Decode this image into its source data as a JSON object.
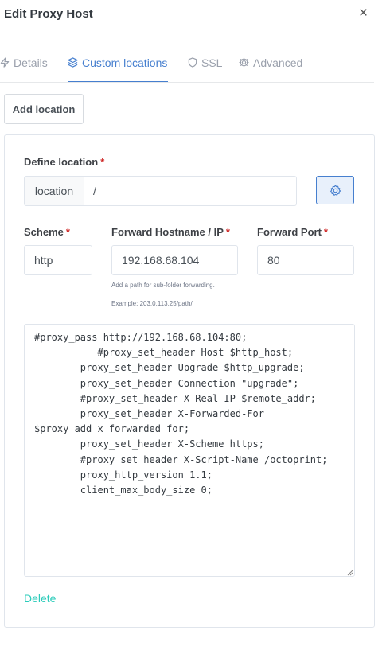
{
  "modal": {
    "title": "Edit Proxy Host",
    "close_label": "×"
  },
  "tabs": [
    {
      "label": "Details",
      "icon": "lightning-icon",
      "active": false
    },
    {
      "label": "Custom locations",
      "icon": "layers-icon",
      "active": true
    },
    {
      "label": "SSL",
      "icon": "shield-icon",
      "active": false
    },
    {
      "label": "Advanced",
      "icon": "gear-icon",
      "active": false
    }
  ],
  "add_location_label": "Add location",
  "location": {
    "define_label": "Define location",
    "required_mark": "*",
    "prefix": "location",
    "path_value": "/",
    "scheme_label": "Scheme",
    "scheme_value": "http",
    "hostname_label": "Forward Hostname / IP",
    "hostname_value": "192.168.68.104",
    "hint_line1": "Add a path for sub-folder forwarding.",
    "hint_line2": "Example: 203.0.113.25/path/",
    "port_label": "Forward Port",
    "port_value": "80",
    "config_lines": [
      "#proxy_pass http://192.168.68.104:80;",
      "           #proxy_set_header Host $http_host;",
      "        proxy_set_header Upgrade $http_upgrade;",
      "        proxy_set_header Connection \"upgrade\";",
      "        #proxy_set_header X-Real-IP $remote_addr;",
      "        proxy_set_header X-Forwarded-For",
      "$proxy_add_x_forwarded_for;",
      "        proxy_set_header X-Scheme https;",
      "        #proxy_set_header X-Script-Name /octoprint;",
      "        proxy_http_version 1.1;",
      "        client_max_body_size 0;"
    ],
    "delete_label": "Delete"
  },
  "colors": {
    "primary": "#467fcf",
    "required": "#cd201f",
    "delete": "#2bcbba"
  }
}
